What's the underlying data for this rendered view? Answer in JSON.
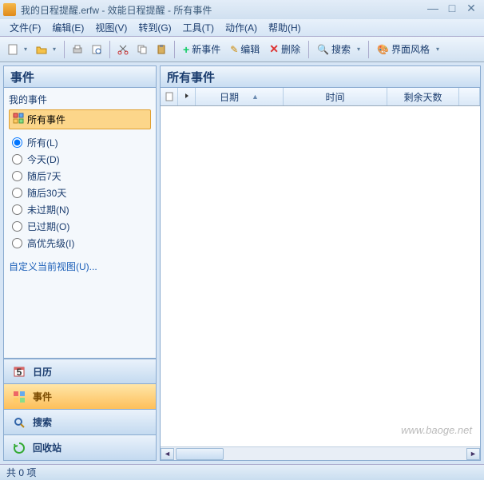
{
  "title": "我的日程提醒.erfw - 效能日程提醒 - 所有事件",
  "menu": [
    "文件(F)",
    "编辑(E)",
    "视图(V)",
    "转到(G)",
    "工具(T)",
    "动作(A)",
    "帮助(H)"
  ],
  "toolbar": {
    "new_event": "新事件",
    "edit": "编辑",
    "delete": "删除",
    "search": "搜索",
    "style": "界面风格"
  },
  "sidebar": {
    "header": "事件",
    "my_events": "我的事件",
    "all_events": "所有事件",
    "filters": [
      {
        "label": "所有(L)",
        "checked": true
      },
      {
        "label": "今天(D)",
        "checked": false
      },
      {
        "label": "随后7天",
        "checked": false
      },
      {
        "label": "随后30天",
        "checked": false
      },
      {
        "label": "未过期(N)",
        "checked": false
      },
      {
        "label": "已过期(O)",
        "checked": false
      },
      {
        "label": "高优先级(I)",
        "checked": false
      }
    ],
    "customize": "自定义当前视图(U)...",
    "nav": [
      {
        "label": "日历",
        "icon": "calendar"
      },
      {
        "label": "事件",
        "icon": "events",
        "active": true
      },
      {
        "label": "搜索",
        "icon": "search"
      },
      {
        "label": "回收站",
        "icon": "recycle"
      }
    ]
  },
  "content": {
    "header": "所有事件",
    "columns": [
      "日期",
      "时间",
      "剩余天数"
    ]
  },
  "status": "共 0 项",
  "watermark": "www.baoge.net"
}
